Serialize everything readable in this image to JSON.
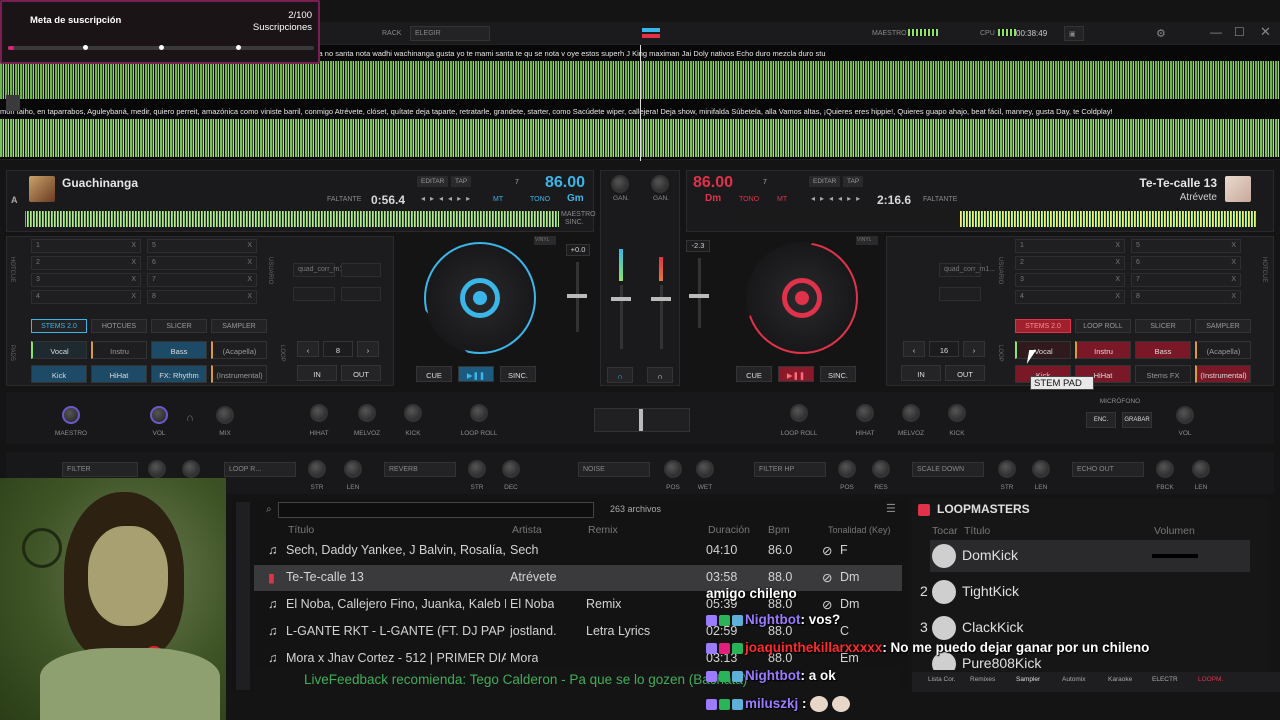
{
  "subscription": {
    "title": "Meta de suscripción",
    "count": "2/100",
    "label": "Suscripciones",
    "progress": 0.02
  },
  "topbar": {
    "rack": "RACK",
    "select": "ELEGIR",
    "master": "MAESTRO",
    "cpu": "CPU",
    "clock": "00:38:49"
  },
  "lyrics": {
    "line1": "res veo deseo perreo conmigo coqueteo tú quieres veo deseo perreo wachinanga le la pachanga no santa nota wadhi wachinanga gusta  yo te mami santa te qu  se nota v     oye estos superh    J King maximan Jai Doly nativos Echo duro mezcla duro stu",
    "line2": "mon taiho, en taparrabos, Aguleybaná, medir, quiero perreit, amazónica como viniste barril, conmigo Atrévete, clóset, quítate deja taparte, retratarle, grandete, starter, como Sacúdete wiper, callejera! Deja show, minifalda Súbetela, alla Vamos altas, ¡Quieres eres hippie!, Quieres guapo ahajo, beat fácil, manney, gusta Day, te Coldplay!"
  },
  "deckA": {
    "letter": "A",
    "title": "Guachinanga",
    "remaining_label": "FALTANTE",
    "remaining": "0:56.4",
    "bpm": "86.00",
    "key": "Gm",
    "key_num": "7",
    "edit": "EDITAR",
    "tap": "TAP",
    "mt": "MT",
    "tono": "TONO",
    "master_label": "MAESTRO",
    "sync_label": "SINC.",
    "pitch": "+0.0",
    "hotcues": [
      "1",
      "2",
      "3",
      "4",
      "5",
      "6",
      "7",
      "8"
    ],
    "tabs": [
      "STEMS 2.0",
      "HOTCUES",
      "SLICER",
      "SAMPLER"
    ],
    "pads": [
      "Vocal",
      "Instru",
      "Bass",
      "(Acapella)",
      "Kick",
      "HiHat",
      "FX: Rhythm",
      "(Instrumental)"
    ],
    "loop_val": "8",
    "in": "IN",
    "out": "OUT",
    "cue": "CUE",
    "sync": "SINC.",
    "slots": [
      "quad_corr_m1..."
    ]
  },
  "deckB": {
    "title": "Te-Te-calle 13",
    "artist": "Atrévete",
    "remaining_label": "FALTANTE",
    "remaining": "2:16.6",
    "bpm": "86.00",
    "key": "Dm",
    "key_num": "7",
    "edit": "EDITAR",
    "tap": "TAP",
    "mt": "MT",
    "tono": "TONO",
    "pitch": "-2.3",
    "hotcues": [
      "1",
      "2",
      "3",
      "4",
      "5",
      "6",
      "7",
      "8"
    ],
    "tabs": [
      "STEMS 2.0",
      "LOOP ROLL",
      "SLICER",
      "SAMPLER"
    ],
    "pads": [
      "Vocal",
      "Instru",
      "Bass",
      "(Acapella)",
      "Kick",
      "HiHat",
      "Stems FX",
      "(Instrumental)"
    ],
    "loop_val": "16",
    "in": "IN",
    "out": "OUT",
    "cue": "CUE",
    "sync": "SINC.",
    "slots": [
      "quad_corr_m1..."
    ]
  },
  "mixer": {
    "gain": "GAN.",
    "master": "MAESTRO",
    "vol": "VOL",
    "mix": "MIX",
    "mic": "MICRÓFONO",
    "enc": "ENC.",
    "record": "GRABAR"
  },
  "fx": {
    "left_knobs": [
      "HIHAT",
      "MELVOZ",
      "KICK",
      "LOOP ROLL"
    ],
    "right_knobs": [
      "LOOP ROLL",
      "HIHAT",
      "MELVOZ",
      "KICK"
    ],
    "left_fx": [
      "FILTER",
      "LOOP R...",
      "REVERB"
    ],
    "left_fx_labels": [
      "STR",
      "LEN",
      "STR",
      "DEC"
    ],
    "center_fx": "NOISE",
    "center_labels": [
      "POS",
      "WET"
    ],
    "right_fx": [
      "FILTER HP",
      "SCALE DOWN",
      "ECHO OUT"
    ],
    "right_fx_labels": [
      "POS",
      "RES",
      "STR",
      "LEN",
      "FBCK",
      "LEN"
    ]
  },
  "side_labels": {
    "hotcue": "HOTCUE",
    "usuario": "USUARIO",
    "pads": "PADS",
    "loop": "LOOP",
    "maestro": "MAESTRO",
    "deck": "DECK A",
    "mic": "MIC"
  },
  "tooltip": "STEM PAD",
  "browser": {
    "file_count": "263 archivos",
    "columns": [
      "Título",
      "Artista",
      "Remix",
      "Duración",
      "Bpm",
      "Tonalidad (Key)"
    ],
    "rows": [
      {
        "title": "Sech, Daddy Yankee, J Balvin, Rosalía, Farru...",
        "artist": "Sech",
        "remix": "",
        "dur": "04:10",
        "bpm": "86.0",
        "key": "F"
      },
      {
        "title": "Te-Te-calle 13",
        "artist": "Atrévete",
        "remix": "",
        "dur": "03:58",
        "bpm": "88.0",
        "key": "Dm"
      },
      {
        "title": "El Noba, Callejero Fino, Juanka, Kaleb Di Ma...",
        "artist": "El Noba",
        "remix": "Remix",
        "dur": "05:39",
        "bpm": "88.0",
        "key": "Dm"
      },
      {
        "title": "L-GANTE RKT - L-GANTE (FT. DJ PAPU) 🍓...",
        "artist": "jostland.",
        "remix": "Letra Lyrics",
        "dur": "02:59",
        "bpm": "88.0",
        "key": "C"
      },
      {
        "title": "Mora x Jhav Cortez - 512 | PRIMER DIA DE C...",
        "artist": "Mora",
        "remix": "",
        "dur": "03:13",
        "bpm": "88.0",
        "key": "Em"
      }
    ],
    "livefeedback": "LiveFeedback recomienda: Tego Calderon - Pa que se lo gozen (Bachata)"
  },
  "sampler": {
    "title": "LOOPMASTERS",
    "cols": [
      "Tocar",
      "Título",
      "Volumen"
    ],
    "items": [
      {
        "num": "",
        "name": "DomKick"
      },
      {
        "num": "2",
        "name": "TightKick"
      },
      {
        "num": "3",
        "name": "ClackKick"
      },
      {
        "num": "4",
        "name": "Pure808Kick"
      }
    ],
    "tabs": [
      "Lista Cor.",
      "Remixes",
      "Sampler",
      "Automix",
      "Karaoke",
      "ELECTR",
      "LOOPM."
    ]
  },
  "chat": [
    {
      "user": "",
      "text": "amigo chileno"
    },
    {
      "user": "Nightbot",
      "text": ": vos?"
    },
    {
      "user": "joaquinthekillarxxxxx",
      "text": ": No me puedo dejar ganar por un chileno"
    },
    {
      "user": "Nightbot",
      "text": ": a ok"
    },
    {
      "user": "miluszkj",
      "text": ":"
    }
  ],
  "colors": {
    "deckA": "#3ab6e8",
    "deckB": "#e0324a",
    "accent_pink": "#e0207a",
    "nightbot": "#9b7bff",
    "joaquin": "#ff2a2a"
  }
}
